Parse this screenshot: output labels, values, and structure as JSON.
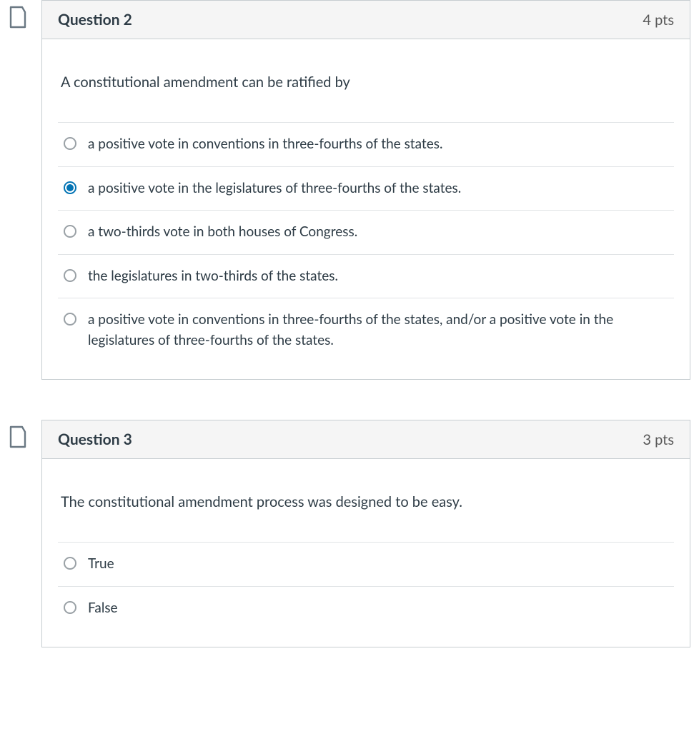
{
  "questions": [
    {
      "title": "Question 2",
      "points": "4 pts",
      "prompt": "A constitutional amendment can be ratified by",
      "options": [
        {
          "text": "a positive vote in conventions in three-fourths of the states.",
          "selected": false
        },
        {
          "text": "a positive vote in the legislatures of three-fourths of the states.",
          "selected": true
        },
        {
          "text": "a two-thirds vote in both houses of Congress.",
          "selected": false
        },
        {
          "text": "the legislatures in two-thirds of the states.",
          "selected": false
        },
        {
          "text": "a positive vote in conventions in three-fourths of the states, and/or a positive vote in the legislatures of three-fourths of the states.",
          "selected": false
        }
      ]
    },
    {
      "title": "Question 3",
      "points": "3 pts",
      "prompt": "The constitutional amendment process was designed to be easy.",
      "options": [
        {
          "text": "True",
          "selected": false
        },
        {
          "text": "False",
          "selected": false
        }
      ]
    }
  ],
  "colors": {
    "border": "#c7cdd1",
    "headerBg": "#f5f5f5",
    "accent": "#0374b5",
    "text": "#2d3b45",
    "bookmarkStroke": "#6a7883"
  }
}
